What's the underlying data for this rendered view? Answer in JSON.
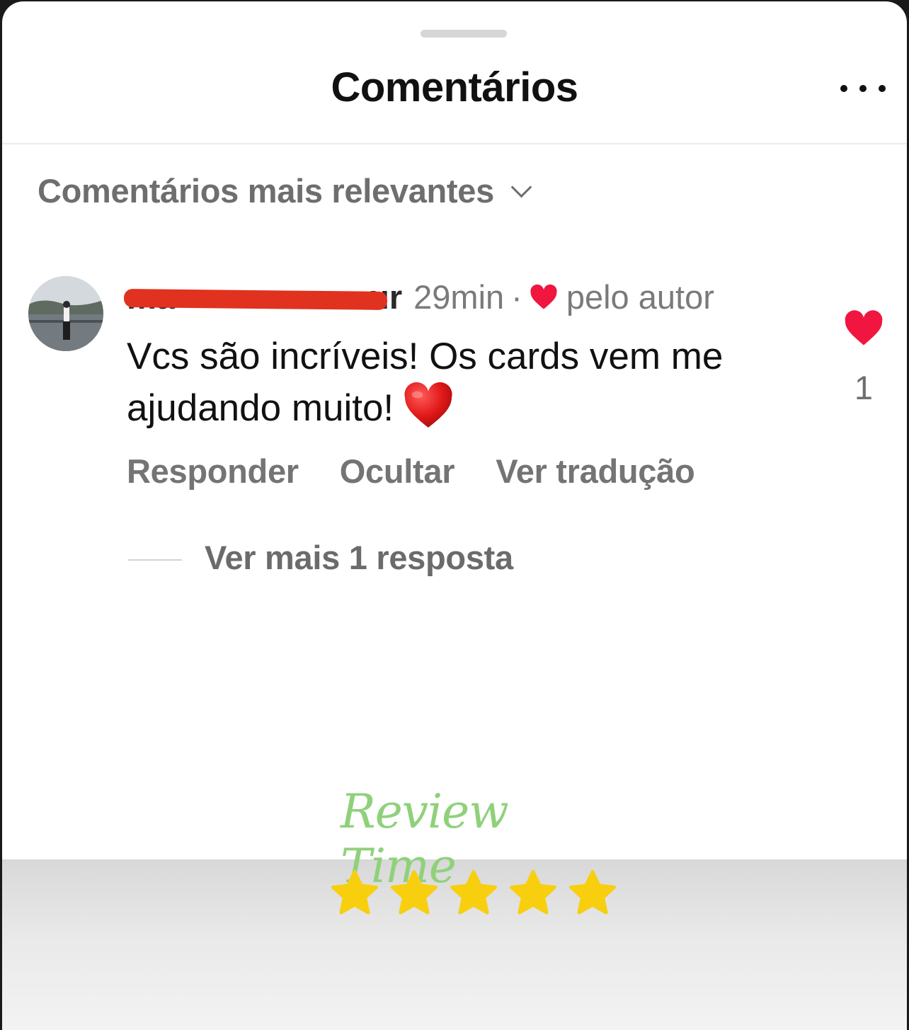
{
  "header": {
    "title": "Comentários",
    "more_icon": "more-horizontal-icon"
  },
  "sort": {
    "label": "Comentários mais relevantes",
    "icon": "chevron-down-icon"
  },
  "comment": {
    "username_visible_suffix": "ur",
    "username_redacted": true,
    "time": "29min",
    "separator": "·",
    "author_liked_label": "pelo autor",
    "text": "Vcs são incríveis! Os cards vem me ajudando muito!",
    "emoji": "red-heart-emoji",
    "like_count": "1",
    "actions": {
      "reply": "Responder",
      "hide": "Ocultar",
      "translate": "Ver tradução"
    },
    "replies_link": "Ver mais 1 resposta"
  },
  "watermark": {
    "text": "Review Time",
    "color": "#8fd17b"
  },
  "rating": {
    "stars": 5,
    "max": 5,
    "color": "#f7cf0f"
  },
  "colors": {
    "like_red": "#f0163f",
    "redaction": "#e0321f"
  }
}
